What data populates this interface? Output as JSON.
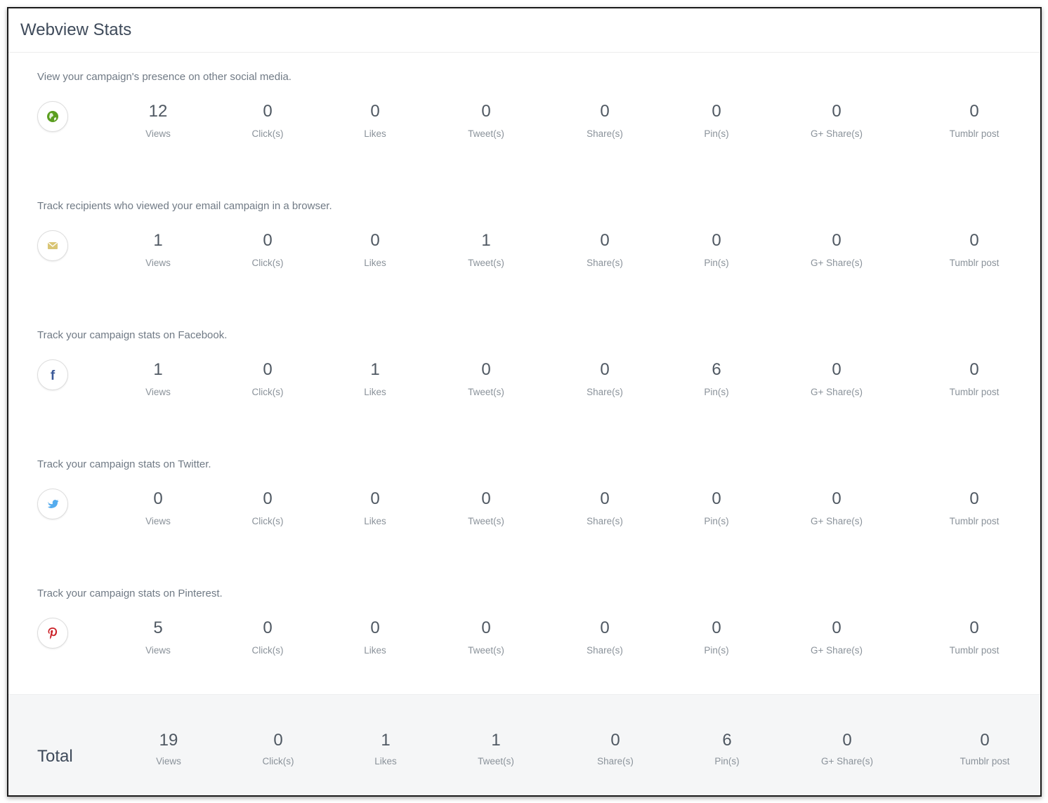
{
  "title": "Webview Stats",
  "labels": [
    "Views",
    "Click(s)",
    "Likes",
    "Tweet(s)",
    "Share(s)",
    "Pin(s)",
    "G+ Share(s)",
    "Tumblr post"
  ],
  "sections": [
    {
      "name": "web",
      "icon": "globe-icon",
      "description": "View your campaign's presence on other social media.",
      "values": [
        "12",
        "0",
        "0",
        "0",
        "0",
        "0",
        "0",
        "0"
      ]
    },
    {
      "name": "email",
      "icon": "envelope-icon",
      "description": "Track recipients who viewed your email campaign in a browser.",
      "values": [
        "1",
        "0",
        "0",
        "1",
        "0",
        "0",
        "0",
        "0"
      ]
    },
    {
      "name": "facebook",
      "icon": "facebook-icon",
      "description": "Track your campaign stats on Facebook.",
      "values": [
        "1",
        "0",
        "1",
        "0",
        "0",
        "6",
        "0",
        "0"
      ]
    },
    {
      "name": "twitter",
      "icon": "twitter-icon",
      "description": "Track your campaign stats on Twitter.",
      "values": [
        "0",
        "0",
        "0",
        "0",
        "0",
        "0",
        "0",
        "0"
      ]
    },
    {
      "name": "pinterest",
      "icon": "pinterest-icon",
      "description": "Track your campaign stats on Pinterest.",
      "values": [
        "5",
        "0",
        "0",
        "0",
        "0",
        "0",
        "0",
        "0"
      ]
    }
  ],
  "total": {
    "label": "Total",
    "values": [
      "19",
      "0",
      "1",
      "1",
      "0",
      "6",
      "0",
      "0"
    ]
  },
  "colors": {
    "globe": "#5a9e1f",
    "envelope": "#d9c574",
    "facebook": "#3b5998",
    "twitter": "#55acee",
    "pinterest": "#cb2027"
  }
}
